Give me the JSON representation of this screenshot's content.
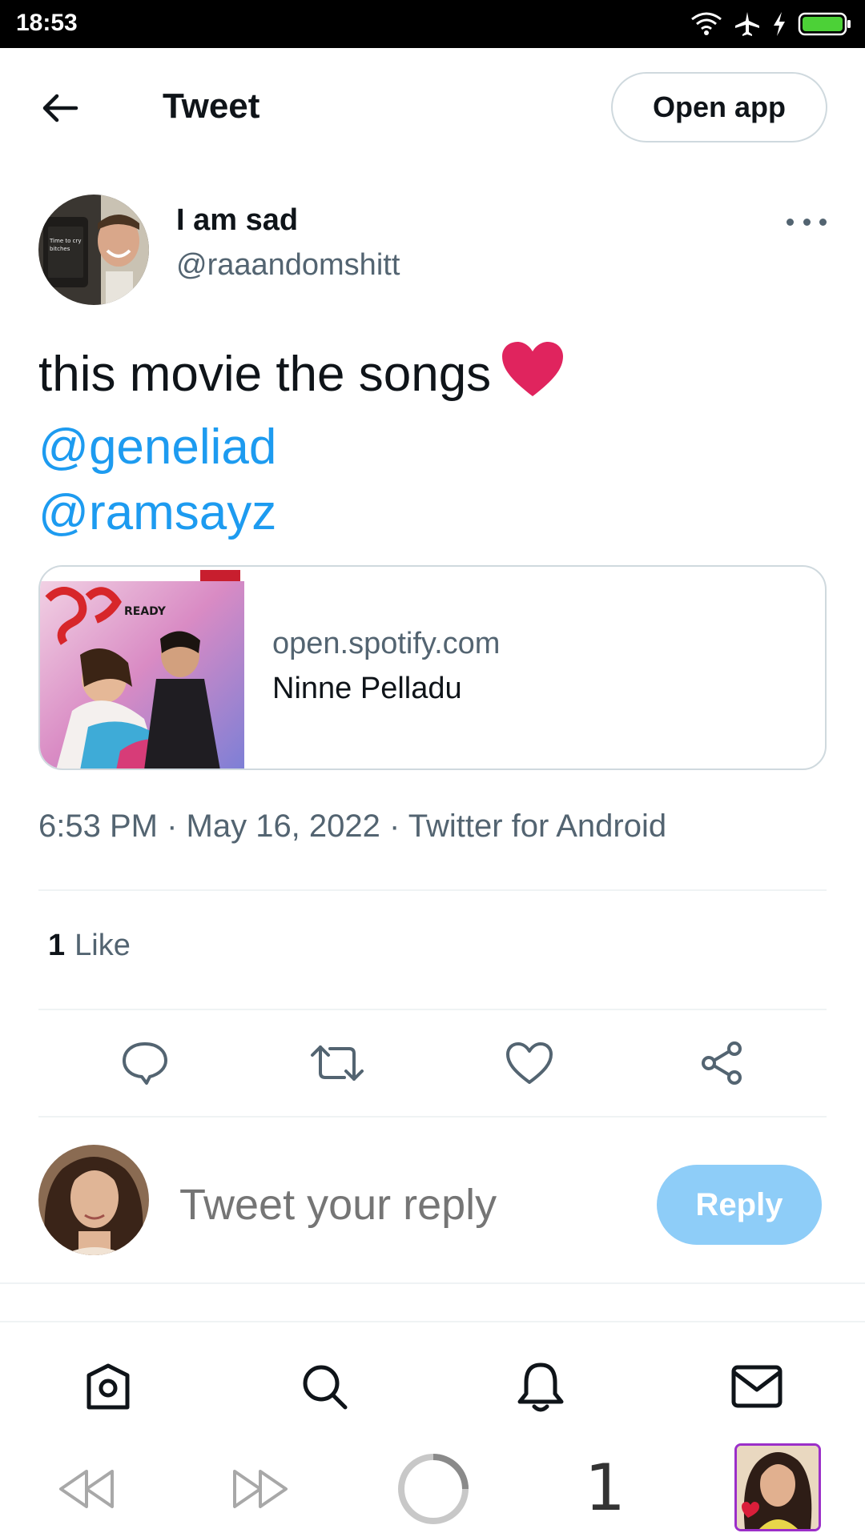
{
  "status_bar": {
    "time": "18:53"
  },
  "header": {
    "title": "Tweet",
    "open_app_label": "Open app"
  },
  "tweet": {
    "author_name": "I am sad",
    "author_handle": "@raaandomshitt",
    "text_line1": "this movie the songs",
    "mention1": "@geneliad",
    "mention2": "@ramsayz",
    "card": {
      "domain": "open.spotify.com",
      "title": "Ninne Pelladu"
    },
    "meta": "6:53 PM · May 16, 2022 · Twitter for Android",
    "likes_count": "1",
    "likes_label": "Like"
  },
  "reply": {
    "placeholder": "Tweet your reply",
    "button_label": "Reply"
  },
  "media_bar": {
    "count": "1"
  },
  "colors": {
    "accent": "#1d9bf0",
    "reply_button": "#8ecdf8",
    "secondary_text": "#536471",
    "heart": "#e0245e"
  },
  "icons": {
    "status": [
      "wifi-icon",
      "airplane-icon",
      "charging-icon",
      "battery-icon"
    ],
    "actions": [
      "reply-icon",
      "retweet-icon",
      "like-icon",
      "share-icon"
    ],
    "nav": [
      "home-icon",
      "search-icon",
      "notifications-icon",
      "messages-icon"
    ],
    "media": [
      "rewind-icon",
      "fast-forward-icon",
      "loading-spinner-icon"
    ]
  }
}
